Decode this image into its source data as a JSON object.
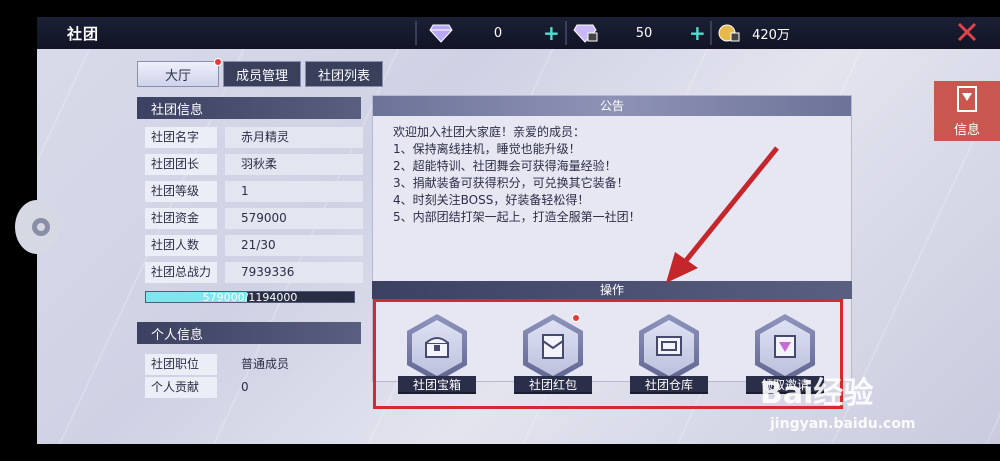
{
  "header": {
    "title": "社团",
    "currency": [
      {
        "icon": "diamond-icon",
        "value": "0",
        "plus": "+"
      },
      {
        "icon": "locked-diamond-icon",
        "value": "50",
        "plus": "+"
      },
      {
        "icon": "gold-coin-icon",
        "value": "420万"
      }
    ],
    "close_icon": "close-icon"
  },
  "tabs": [
    {
      "label": "大厅",
      "active": true,
      "badge": true
    },
    {
      "label": "成员管理",
      "active": false
    },
    {
      "label": "社团列表",
      "active": false
    }
  ],
  "club_info": {
    "title": "社团信息",
    "rows": [
      {
        "key": "社团名字",
        "value": "赤月精灵"
      },
      {
        "key": "社团团长",
        "value": "羽秋柔"
      },
      {
        "key": "社团等级",
        "value": "1"
      },
      {
        "key": "社团资金",
        "value": "579000"
      },
      {
        "key": "社团人数",
        "value": "21/30"
      },
      {
        "key": "社团总战力",
        "value": "7939336"
      }
    ],
    "progress": {
      "text": "579000/1194000",
      "fraction": 0.485
    }
  },
  "personal_info": {
    "title": "个人信息",
    "rows": [
      {
        "key": "社团职位",
        "value": "普通成员"
      },
      {
        "key": "个人贡献",
        "value": "0"
      }
    ]
  },
  "notice": {
    "title": "公告",
    "lines": [
      "欢迎加入社团大家庭！亲爱的成员：",
      "1、保持离线挂机，睡觉也能升级！",
      "2、超能特训、社团舞会可获得海量经验！",
      "3、捐献装备可获得积分，可兑换其它装备！",
      "4、时刻关注BOSS，好装备轻松得！",
      "5、内部团结打架一起上，打造全服第一社团！"
    ]
  },
  "operations": {
    "title": "操作",
    "items": [
      {
        "label": "社团宝箱",
        "icon": "treasure-chest-icon",
        "badge": false
      },
      {
        "label": "社团红包",
        "icon": "red-envelope-icon",
        "badge": true
      },
      {
        "label": "社团仓库",
        "icon": "warehouse-icon",
        "badge": false
      },
      {
        "label": "领取邀请",
        "icon": "calendar-gift-icon",
        "badge": false
      }
    ]
  },
  "side_button": {
    "label": "信息",
    "icon": "info-card-icon"
  },
  "watermark": {
    "brand": "Bai经验",
    "url": "jingyan.baidu.com"
  },
  "colors": {
    "accent_teal": "#4de0d0",
    "highlight_red": "#d42a2a",
    "side_red": "#c8574f"
  }
}
